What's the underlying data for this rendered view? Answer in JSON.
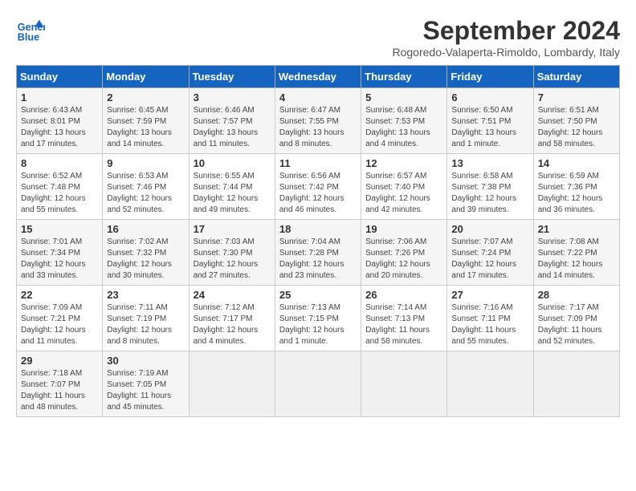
{
  "logo": {
    "line1": "General",
    "line2": "Blue"
  },
  "title": "September 2024",
  "subtitle": "Rogoredo-Valaperta-Rimoldo, Lombardy, Italy",
  "days_of_week": [
    "Sunday",
    "Monday",
    "Tuesday",
    "Wednesday",
    "Thursday",
    "Friday",
    "Saturday"
  ],
  "weeks": [
    [
      {
        "day": "1",
        "info": "Sunrise: 6:43 AM\nSunset: 8:01 PM\nDaylight: 13 hours and 17 minutes."
      },
      {
        "day": "2",
        "info": "Sunrise: 6:45 AM\nSunset: 7:59 PM\nDaylight: 13 hours and 14 minutes."
      },
      {
        "day": "3",
        "info": "Sunrise: 6:46 AM\nSunset: 7:57 PM\nDaylight: 13 hours and 11 minutes."
      },
      {
        "day": "4",
        "info": "Sunrise: 6:47 AM\nSunset: 7:55 PM\nDaylight: 13 hours and 8 minutes."
      },
      {
        "day": "5",
        "info": "Sunrise: 6:48 AM\nSunset: 7:53 PM\nDaylight: 13 hours and 4 minutes."
      },
      {
        "day": "6",
        "info": "Sunrise: 6:50 AM\nSunset: 7:51 PM\nDaylight: 13 hours and 1 minute."
      },
      {
        "day": "7",
        "info": "Sunrise: 6:51 AM\nSunset: 7:50 PM\nDaylight: 12 hours and 58 minutes."
      }
    ],
    [
      {
        "day": "8",
        "info": "Sunrise: 6:52 AM\nSunset: 7:48 PM\nDaylight: 12 hours and 55 minutes."
      },
      {
        "day": "9",
        "info": "Sunrise: 6:53 AM\nSunset: 7:46 PM\nDaylight: 12 hours and 52 minutes."
      },
      {
        "day": "10",
        "info": "Sunrise: 6:55 AM\nSunset: 7:44 PM\nDaylight: 12 hours and 49 minutes."
      },
      {
        "day": "11",
        "info": "Sunrise: 6:56 AM\nSunset: 7:42 PM\nDaylight: 12 hours and 46 minutes."
      },
      {
        "day": "12",
        "info": "Sunrise: 6:57 AM\nSunset: 7:40 PM\nDaylight: 12 hours and 42 minutes."
      },
      {
        "day": "13",
        "info": "Sunrise: 6:58 AM\nSunset: 7:38 PM\nDaylight: 12 hours and 39 minutes."
      },
      {
        "day": "14",
        "info": "Sunrise: 6:59 AM\nSunset: 7:36 PM\nDaylight: 12 hours and 36 minutes."
      }
    ],
    [
      {
        "day": "15",
        "info": "Sunrise: 7:01 AM\nSunset: 7:34 PM\nDaylight: 12 hours and 33 minutes."
      },
      {
        "day": "16",
        "info": "Sunrise: 7:02 AM\nSunset: 7:32 PM\nDaylight: 12 hours and 30 minutes."
      },
      {
        "day": "17",
        "info": "Sunrise: 7:03 AM\nSunset: 7:30 PM\nDaylight: 12 hours and 27 minutes."
      },
      {
        "day": "18",
        "info": "Sunrise: 7:04 AM\nSunset: 7:28 PM\nDaylight: 12 hours and 23 minutes."
      },
      {
        "day": "19",
        "info": "Sunrise: 7:06 AM\nSunset: 7:26 PM\nDaylight: 12 hours and 20 minutes."
      },
      {
        "day": "20",
        "info": "Sunrise: 7:07 AM\nSunset: 7:24 PM\nDaylight: 12 hours and 17 minutes."
      },
      {
        "day": "21",
        "info": "Sunrise: 7:08 AM\nSunset: 7:22 PM\nDaylight: 12 hours and 14 minutes."
      }
    ],
    [
      {
        "day": "22",
        "info": "Sunrise: 7:09 AM\nSunset: 7:21 PM\nDaylight: 12 hours and 11 minutes."
      },
      {
        "day": "23",
        "info": "Sunrise: 7:11 AM\nSunset: 7:19 PM\nDaylight: 12 hours and 8 minutes."
      },
      {
        "day": "24",
        "info": "Sunrise: 7:12 AM\nSunset: 7:17 PM\nDaylight: 12 hours and 4 minutes."
      },
      {
        "day": "25",
        "info": "Sunrise: 7:13 AM\nSunset: 7:15 PM\nDaylight: 12 hours and 1 minute."
      },
      {
        "day": "26",
        "info": "Sunrise: 7:14 AM\nSunset: 7:13 PM\nDaylight: 11 hours and 58 minutes."
      },
      {
        "day": "27",
        "info": "Sunrise: 7:16 AM\nSunset: 7:11 PM\nDaylight: 11 hours and 55 minutes."
      },
      {
        "day": "28",
        "info": "Sunrise: 7:17 AM\nSunset: 7:09 PM\nDaylight: 11 hours and 52 minutes."
      }
    ],
    [
      {
        "day": "29",
        "info": "Sunrise: 7:18 AM\nSunset: 7:07 PM\nDaylight: 11 hours and 48 minutes."
      },
      {
        "day": "30",
        "info": "Sunrise: 7:19 AM\nSunset: 7:05 PM\nDaylight: 11 hours and 45 minutes."
      },
      {
        "day": "",
        "info": ""
      },
      {
        "day": "",
        "info": ""
      },
      {
        "day": "",
        "info": ""
      },
      {
        "day": "",
        "info": ""
      },
      {
        "day": "",
        "info": ""
      }
    ]
  ]
}
